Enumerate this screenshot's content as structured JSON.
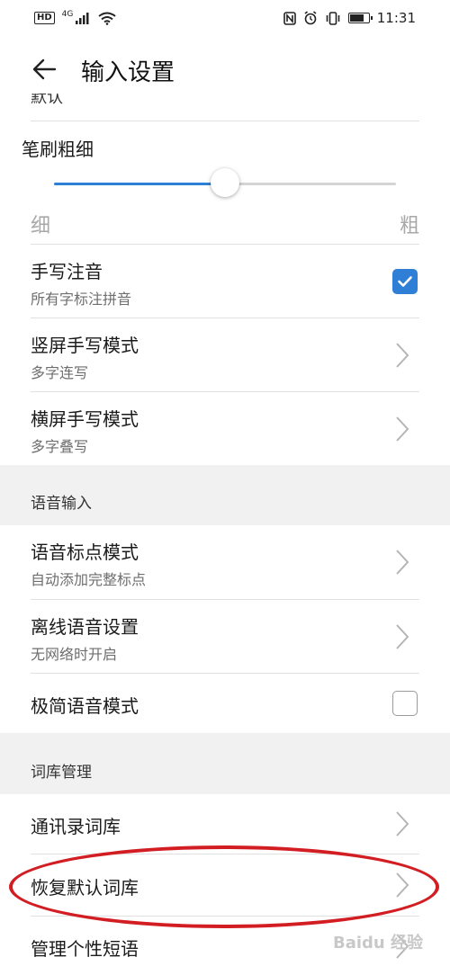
{
  "status_bar": {
    "hd": "HD",
    "network": "4G",
    "time": "11:31"
  },
  "header": {
    "title": "输入设置",
    "back_icon": "arrow-left-icon"
  },
  "clipped_row_text": "默认",
  "stroke": {
    "title": "笔刷粗细",
    "min_label": "细",
    "max_label": "粗",
    "value_fraction": 0.5
  },
  "handwriting": [
    {
      "title": "手写注音",
      "subtitle": "所有字标注拼音",
      "control": "checkbox",
      "checked": true
    },
    {
      "title": "竖屏手写模式",
      "subtitle": "多字连写",
      "control": "chevron"
    },
    {
      "title": "横屏手写模式",
      "subtitle": "多字叠写",
      "control": "chevron"
    }
  ],
  "voice_section": {
    "label": "语音输入"
  },
  "voice": [
    {
      "title": "语音标点模式",
      "subtitle": "自动添加完整标点",
      "control": "chevron"
    },
    {
      "title": "离线语音设置",
      "subtitle": "无网络时开启",
      "control": "chevron"
    },
    {
      "title": "极简语音模式",
      "control": "checkbox",
      "checked": false
    }
  ],
  "dict_section": {
    "label": "词库管理"
  },
  "dict": [
    {
      "title": "通讯录词库",
      "control": "chevron"
    },
    {
      "title": "恢复默认词库",
      "control": "chevron"
    },
    {
      "title": "管理个性短语",
      "control": "chevron"
    }
  ],
  "annotation": {
    "color": "#d21e23",
    "shape": "oval-highlight"
  },
  "colors": {
    "accent": "#2f7fd6",
    "section_bg": "#f1f1f1"
  },
  "watermark": "Baidu 经验"
}
